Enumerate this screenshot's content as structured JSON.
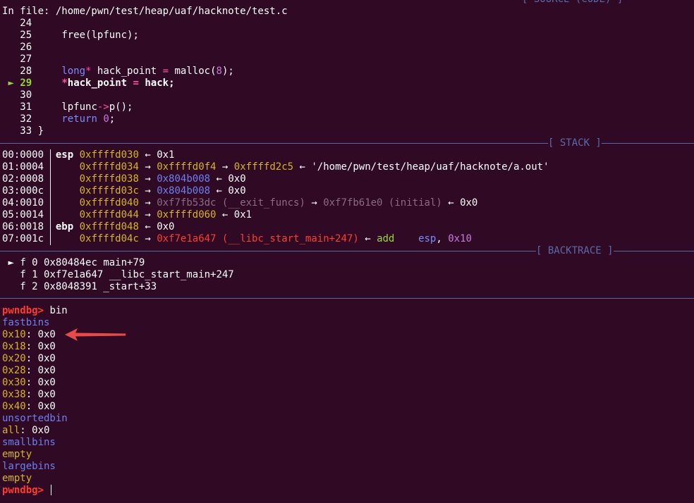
{
  "source": {
    "label": "[ SOURCE (CODE) ]",
    "file_prefix": "In file: ",
    "file_path": "/home/pwn/test/heap/uaf/hacknote/test.c",
    "lines": [
      {
        "no": "24",
        "code": ""
      },
      {
        "no": "25",
        "code": "free(lpfunc);"
      },
      {
        "no": "26",
        "code": ""
      },
      {
        "no": "27",
        "code": ""
      },
      {
        "no": "28",
        "code": "long* hack_point = malloc(8);"
      },
      {
        "no": "29",
        "code": "*hack_point = hack;"
      },
      {
        "no": "30",
        "code": ""
      },
      {
        "no": "31",
        "code": "lpfunc->p();"
      },
      {
        "no": "32",
        "code": "return 0;"
      },
      {
        "no": "33",
        "code": "}"
      }
    ],
    "current_marker": "►"
  },
  "stack": {
    "label": "[ STACK ]",
    "rows": [
      {
        "idx": "00:0000",
        "reg": "esp",
        "addr": "0xffffd030",
        "chain": "← 0x1"
      },
      {
        "idx": "01:0004",
        "reg": "",
        "addr": "0xffffd034",
        "chain": "→ 0xffffd0f4 → 0xffffd2c5 ← '/home/pwn/test/heap/uaf/hacknote/a.out'"
      },
      {
        "idx": "02:0008",
        "reg": "",
        "addr": "0xffffd038",
        "chain": "→ 0x804b008 ← 0x0"
      },
      {
        "idx": "03:000c",
        "reg": "",
        "addr": "0xffffd03c",
        "chain": "→ 0x804b008 ← 0x0"
      },
      {
        "idx": "04:0010",
        "reg": "",
        "addr": "0xffffd040",
        "chain": "→ 0xf7fb53dc (__exit_funcs) → 0xf7fb61e0 (initial) ← 0x0"
      },
      {
        "idx": "05:0014",
        "reg": "",
        "addr": "0xffffd044",
        "chain": "→ 0xffffd060 ← 0x1"
      },
      {
        "idx": "06:0018",
        "reg": "ebp",
        "addr": "0xffffd048",
        "chain": "← 0x0"
      },
      {
        "idx": "07:001c",
        "reg": "",
        "addr": "0xffffd04c",
        "chain": "→ 0xf7e1a647 (__libc_start_main+247) ← add    esp, 0x10"
      }
    ]
  },
  "backtrace": {
    "label": "[ BACKTRACE ]",
    "marker": "►",
    "frames": [
      "f 0 0x80484ec main+79",
      "f 1 0xf7e1a647 __libc_start_main+247",
      "f 2 0x8048391 _start+33"
    ]
  },
  "console": {
    "prompt": "pwndbg>",
    "command": "bin",
    "fastbins_label": "fastbins",
    "fastbins": [
      {
        "size": "0x10",
        "value": "0x0"
      },
      {
        "size": "0x18",
        "value": "0x0"
      },
      {
        "size": "0x20",
        "value": "0x0"
      },
      {
        "size": "0x28",
        "value": "0x0"
      },
      {
        "size": "0x30",
        "value": "0x0"
      },
      {
        "size": "0x38",
        "value": "0x0"
      },
      {
        "size": "0x40",
        "value": "0x0"
      }
    ],
    "unsortedbin_label": "unsortedbin",
    "unsorted_all": "all",
    "unsorted_value": "0x0",
    "smallbins_label": "smallbins",
    "smallbins_value": "empty",
    "largebins_label": "largebins",
    "largebins_value": "empty"
  },
  "colors": {
    "background": "#300a24",
    "annotation_arrow": "#e84a4a"
  }
}
